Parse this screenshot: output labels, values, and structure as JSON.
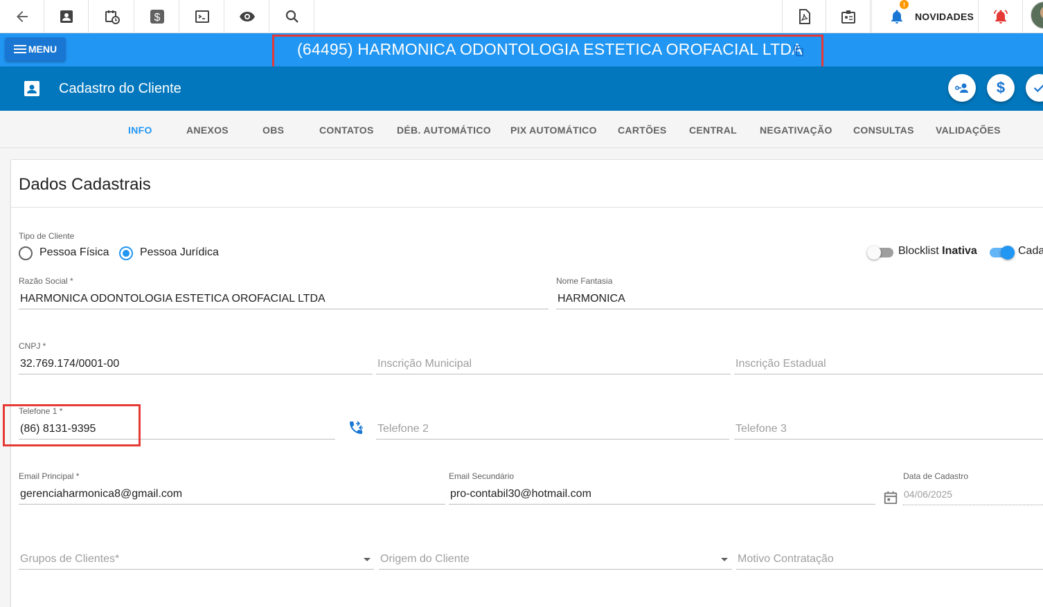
{
  "toolbar": {
    "icons": [
      "back-arrow-icon",
      "contact-card-icon",
      "calendar-clock-icon",
      "dollar-icon",
      "terminal-icon",
      "eye-icon",
      "search-icon",
      "pdf-icon",
      "badge-icon",
      "bell-icon",
      "alarm-icon"
    ],
    "novidades_label": "NOVIDADES",
    "notification_count": "!"
  },
  "title_band": {
    "menu_label": "MENU",
    "client_title": "(64495) HARMONICA ODONTOLOGIA ESTETICA OROFACIAL LTDA"
  },
  "header": {
    "title": "Cadastro do Cliente"
  },
  "tabs": [
    {
      "label": "INFO",
      "active": true
    },
    {
      "label": "ANEXOS"
    },
    {
      "label": "OBS"
    },
    {
      "label": "CONTATOS"
    },
    {
      "label": "DÉB. AUTOMÁTICO"
    },
    {
      "label": "PIX AUTOMÁTICO"
    },
    {
      "label": "CARTÕES"
    },
    {
      "label": "CENTRAL"
    },
    {
      "label": "NEGATIVAÇÃO"
    },
    {
      "label": "CONSULTAS"
    },
    {
      "label": "VALIDAÇÕES"
    }
  ],
  "form": {
    "section_title": "Dados Cadastrais",
    "tipo_cliente": {
      "label": "Tipo de Cliente",
      "options": [
        "Pessoa Física",
        "Pessoa Jurídica"
      ],
      "selected": "Pessoa Jurídica"
    },
    "blocklist": {
      "label": "Blocklist",
      "state_label": "Inativa",
      "on": false
    },
    "cadastro_switch": {
      "label": "Cada",
      "on": true
    },
    "razao_social": {
      "label": "Razão Social *",
      "value": "HARMONICA ODONTOLOGIA ESTETICA OROFACIAL LTDA"
    },
    "nome_fantasia": {
      "label": "Nome Fantasia",
      "value": "HARMONICA"
    },
    "cnpj": {
      "label": "CNPJ *",
      "value": "32.769.174/0001-00"
    },
    "inscricao_municipal": {
      "placeholder": "Inscrição Municipal"
    },
    "inscricao_estadual": {
      "placeholder": "Inscrição Estadual"
    },
    "telefone1": {
      "label": "Telefone 1 *",
      "value": "(86) 8131-9395"
    },
    "telefone2": {
      "placeholder": "Telefone 2"
    },
    "telefone3": {
      "placeholder": "Telefone 3"
    },
    "email_principal": {
      "label": "Email Principal *",
      "value": "gerenciaharmonica8@gmail.com"
    },
    "email_secundario": {
      "label": "Email Secundário",
      "value": "pro-contabil30@hotmail.com"
    },
    "data_cadastro": {
      "label": "Data de Cadastro",
      "value": "04/06/2025"
    },
    "grupos_clientes": {
      "placeholder": "Grupos de Clientes*"
    },
    "origem_cliente": {
      "placeholder": "Origem do Cliente"
    },
    "motivo_contratacao": {
      "placeholder": "Motivo Contratação"
    }
  },
  "colors": {
    "title_band": "#2196f3",
    "header_band": "#0277bd",
    "accent": "#2196f3",
    "highlight_box": "#e53935"
  }
}
